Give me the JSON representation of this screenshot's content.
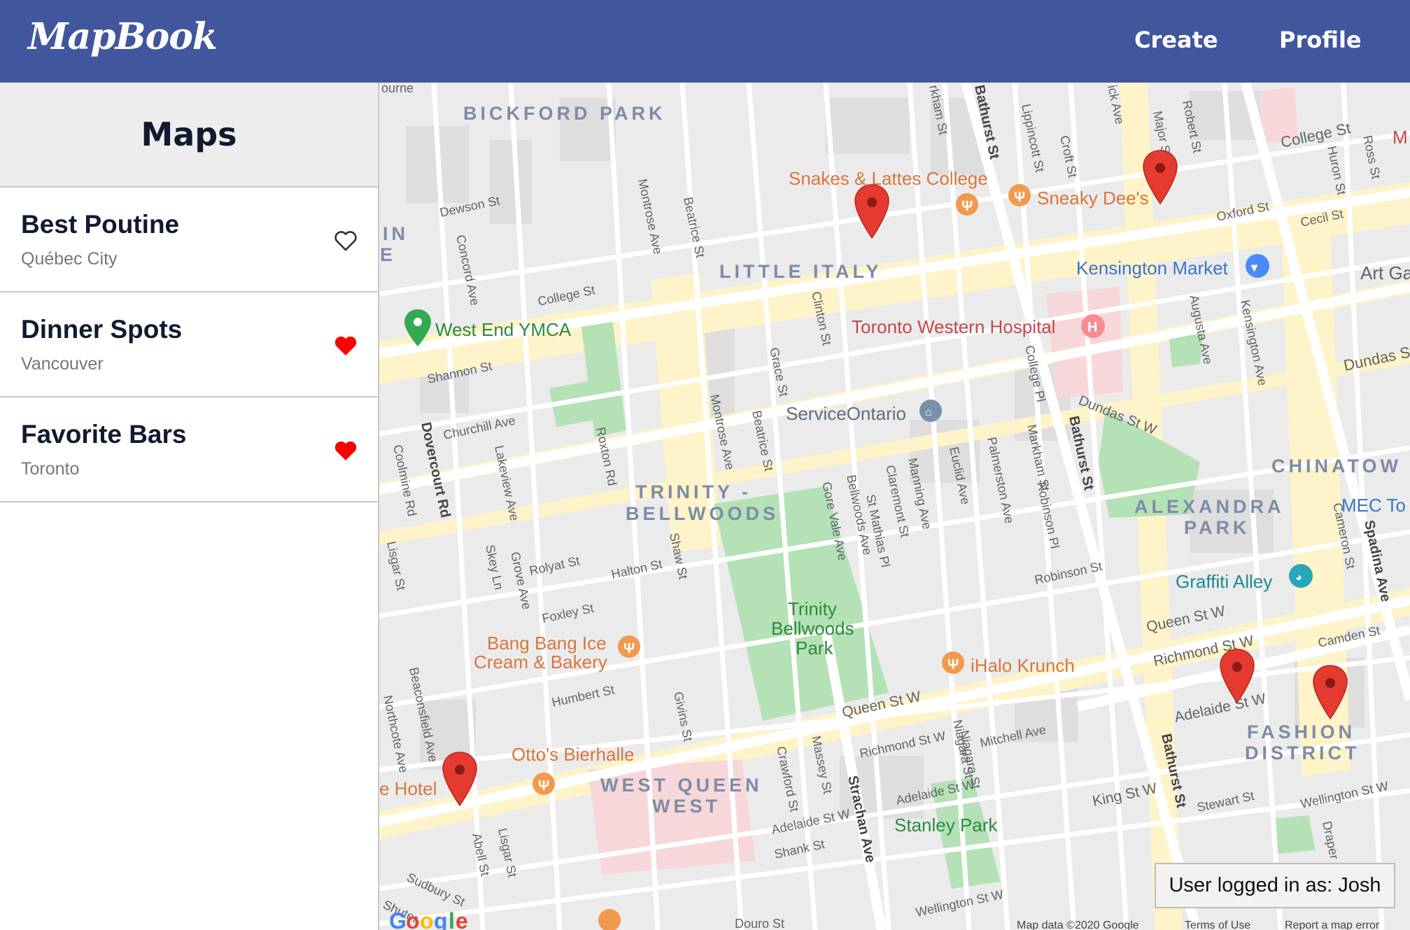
{
  "navbar": {
    "brand": "MapBook",
    "links": [
      "Create",
      "Profile"
    ]
  },
  "sidebar": {
    "title": "Maps",
    "items": [
      {
        "name": "Best Poutine",
        "location": "Québec City",
        "favorite": false
      },
      {
        "name": "Dinner Spots",
        "location": "Vancouver",
        "favorite": true
      },
      {
        "name": "Favorite Bars",
        "location": "Toronto",
        "favorite": true
      }
    ]
  },
  "map": {
    "neighborhoods": [
      "BICKFORD PARK",
      "LITTLE ITALY",
      "TRINITY -",
      "BELLWOODS",
      "ALEXANDRA",
      "PARK",
      "WEST QUEEN",
      "WEST",
      "FASHION",
      "DISTRICT",
      "CHINATOW",
      "IN",
      "E"
    ],
    "pois": {
      "snakes": "Snakes & Lattes College",
      "sneaky": "Sneaky Dee's",
      "kensington": "Kensington Market",
      "ymca": "West End YMCA",
      "hospital": "Toronto Western Hospital",
      "serviceontario": "ServiceOntario",
      "trinity1": "Trinity",
      "trinity2": "Bellwoods",
      "trinity3": "Park",
      "graffiti": "Graffiti Alley",
      "mec": "MEC To",
      "bangbang1": "Bang Bang Ice",
      "bangbang2": "Cream & Bakery",
      "ihalo": "iHalo Krunch",
      "ottos": "Otto's Bierhalle",
      "hotel": "e Hotel",
      "stanley": "Stanley Park",
      "artga": "Art Ga",
      "m": "M"
    },
    "streets": {
      "college1": "College St",
      "college2": "College St",
      "dewson": "Dewson St",
      "shannon": "Shannon St",
      "churchill": "Churchill Ave",
      "dovercourt": "Dovercourt Rd",
      "coolmine": "Coolmine Rd",
      "concord": "Concord Ave",
      "lakeview": "Lakeview Ave",
      "montrose1": "Montrose Ave",
      "montrose2": "Montrose Ave",
      "beatrice1": "Beatrice St",
      "beatrice2": "Beatrice St",
      "roxton": "Roxton Rd",
      "clinton": "Clinton St",
      "grace": "Grace St",
      "shaw": "Shaw St",
      "gorevale": "Gore Vale Ave",
      "bellwoods": "Bellwoods Ave",
      "stmatthias": "St Mathias Pl",
      "claremont": "Claremont St",
      "manning": "Manning Ave",
      "euclid": "Euclid Ave",
      "palmerston": "Palmerston Ave",
      "markham1": "Markham St",
      "markham2": "rkham St",
      "robinsonpl": "Robinson Pl",
      "robinsonst": "Robinson St",
      "bathurst1": "Bathurst St",
      "bathurst2": "Bathurst St",
      "bathurst3": "Bathurst St",
      "lippincott": "Lippincott St",
      "croft": "Croft St",
      "major": "Major St",
      "robert": "Robert St",
      "brick": "ick Ave",
      "dundas1": "Dundas St W",
      "dundas2": "Dundas St",
      "augusta": "Augusta Ave",
      "kensingtonave": "Kensington Ave",
      "oxford": "Oxford St",
      "cecil": "Cecil St",
      "huron": "Huron St",
      "ross": "Ross St",
      "collegept": "College Pl",
      "queen1": "Queen St W",
      "queen2": "Queen St W",
      "richmond1": "Richmond St W",
      "richmond2": "Richmond St W",
      "adelaide1": "Adelaide St W",
      "adelaide2": "Adelaide St W",
      "adelaide3": "Adelaide St W",
      "king": "King St W",
      "wellington1": "Wellington St W",
      "wellington2": "Wellington St W",
      "stewart": "Stewart St",
      "camden": "Camden St",
      "cameron": "Cameron St",
      "spadina": "Spadina Ave",
      "draper": "Draper St",
      "mitchell": "Mitchell Ave",
      "niagara1": "Niagara St",
      "niagara2": "Niagara St",
      "strachan": "Strachan Ave",
      "massey": "Massey St",
      "crawford": "Crawford St",
      "shank": "Shank St",
      "givins": "Givins St",
      "humbert": "Humbert St",
      "halton": "Halton St",
      "rolyat": "Rolyat St",
      "foxley": "Foxley St",
      "skyln": "Skey Ln",
      "grove": "Grove Ave",
      "lisgar1": "Lisgar St",
      "lisgar2": "Lisgar St",
      "beaconsfield": "Beaconsfield Ave",
      "northcote": "Northcote Ave",
      "abell": "Abell St",
      "sudbury": "Sudbury St",
      "douro": "Douro St",
      "shuter": "Shuter",
      "bourne": "ourne"
    },
    "footer": [
      "Map data ©2020 Google",
      "Terms of Use",
      "Report a map error"
    ],
    "google": [
      "G",
      "o",
      "o",
      "g",
      "l",
      "e"
    ]
  },
  "status": {
    "user_logged": "User logged in as: Josh"
  },
  "colors": {
    "navbar": "#41569c",
    "heart_filled": "#ff0000",
    "marker": "#e53a2f",
    "park": "#b5e1b7",
    "road": "#ffffff",
    "main_road": "#fff3c9"
  }
}
